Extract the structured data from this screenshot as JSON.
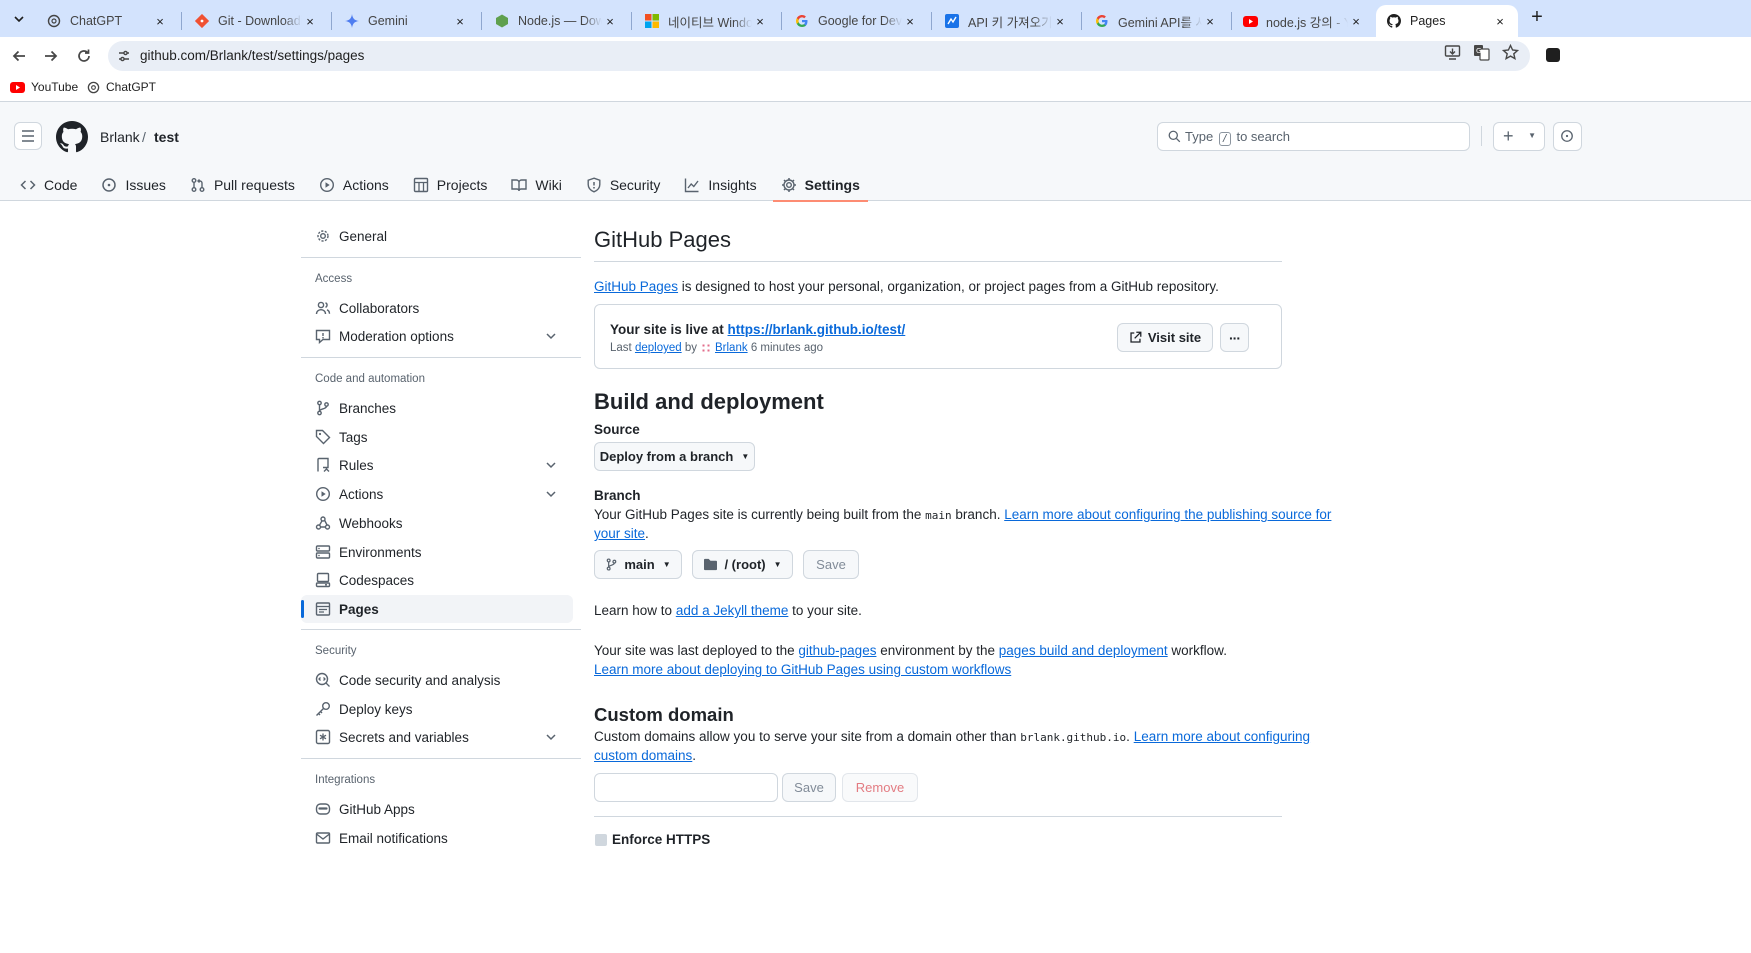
{
  "browser": {
    "tabs": [
      {
        "label": "ChatGPT",
        "close": "×"
      },
      {
        "label": "Git - Downloading",
        "close": "×"
      },
      {
        "label": "Gemini",
        "close": "×"
      },
      {
        "label": "Node.js — Download",
        "close": "×"
      },
      {
        "label": "네이티브 Windows",
        "close": "×"
      },
      {
        "label": "Google for Developers",
        "close": "×"
      },
      {
        "label": "API 키 가져오기",
        "close": "×"
      },
      {
        "label": "Gemini API를 사용",
        "close": "×"
      },
      {
        "label": "node.js 강의 - YouTube",
        "close": "×"
      },
      {
        "label": "Pages",
        "close": "×"
      }
    ],
    "url": "github.com/Brlank/test/settings/pages",
    "bookmarks": [
      {
        "label": "YouTube"
      },
      {
        "label": "ChatGPT"
      }
    ]
  },
  "header": {
    "owner": "Brlank",
    "separator": "/",
    "repo": "test",
    "search_before": "Type",
    "search_key": "/",
    "search_after": "to search"
  },
  "repo_nav": [
    {
      "label": "Code",
      "icon": "code-icon"
    },
    {
      "label": "Issues",
      "icon": "issue-icon"
    },
    {
      "label": "Pull requests",
      "icon": "pull-request-icon"
    },
    {
      "label": "Actions",
      "icon": "play-icon"
    },
    {
      "label": "Projects",
      "icon": "table-icon"
    },
    {
      "label": "Wiki",
      "icon": "book-icon"
    },
    {
      "label": "Security",
      "icon": "shield-icon"
    },
    {
      "label": "Insights",
      "icon": "graph-icon"
    },
    {
      "label": "Settings",
      "icon": "gear-icon",
      "selected": true
    }
  ],
  "sidebar": {
    "general": "General",
    "groups": {
      "access": "Access",
      "code_automation": "Code and automation",
      "security": "Security",
      "integrations": "Integrations"
    },
    "items": {
      "collaborators": "Collaborators",
      "moderation": "Moderation options",
      "branches": "Branches",
      "tags": "Tags",
      "rules": "Rules",
      "actions": "Actions",
      "webhooks": "Webhooks",
      "environments": "Environments",
      "codespaces": "Codespaces",
      "pages": "Pages",
      "code_security": "Code security and analysis",
      "deploy_keys": "Deploy keys",
      "secrets": "Secrets and variables",
      "github_apps": "GitHub Apps",
      "email_notifications": "Email notifications"
    }
  },
  "main": {
    "title": "GitHub Pages",
    "intro_link": "GitHub Pages",
    "intro_rest": " is designed to host your personal, organization, or project pages from a GitHub repository.",
    "live": {
      "prefix": "Your site is live at ",
      "url": "https://brlank.github.io/test/",
      "last": "Last",
      "deployed": "deployed",
      "by": "by",
      "user": "Brlank",
      "ago": "6 minutes ago",
      "visit": "Visit site",
      "more": "···"
    },
    "build": {
      "title": "Build and deployment",
      "source_label": "Source",
      "source_value": "Deploy from a branch",
      "branch_label": "Branch",
      "branch_text_1": "Your GitHub Pages site is currently being built from the ",
      "branch_code": "main",
      "branch_text_2": " branch. ",
      "branch_link_1": "Learn more about configuring the publishing source for",
      "branch_link_2": "your site",
      "branch_end": ".",
      "branch_value": "main",
      "folder_value": "/ (root)",
      "save": "Save",
      "jekyll_1": "Learn how to ",
      "jekyll_link": "add a Jekyll theme",
      "jekyll_2": " to your site.",
      "deployed_1": "Your site was last deployed to the ",
      "deployed_env": "github-pages",
      "deployed_2": " environment by the ",
      "deployed_wf": "pages build and deployment",
      "deployed_3": " workflow.",
      "workflows_link": "Learn more about deploying to GitHub Pages using custom workflows"
    },
    "custom_domain": {
      "title": "Custom domain",
      "text_1": "Custom domains allow you to serve your site from a domain other than ",
      "code": "brlank.github.io",
      "text_2": ". ",
      "link_1": "Learn more about configuring",
      "link_2": "custom domains",
      "end": ".",
      "input_value": "",
      "save": "Save",
      "remove": "Remove"
    },
    "https": {
      "label": "Enforce HTTPS"
    }
  }
}
